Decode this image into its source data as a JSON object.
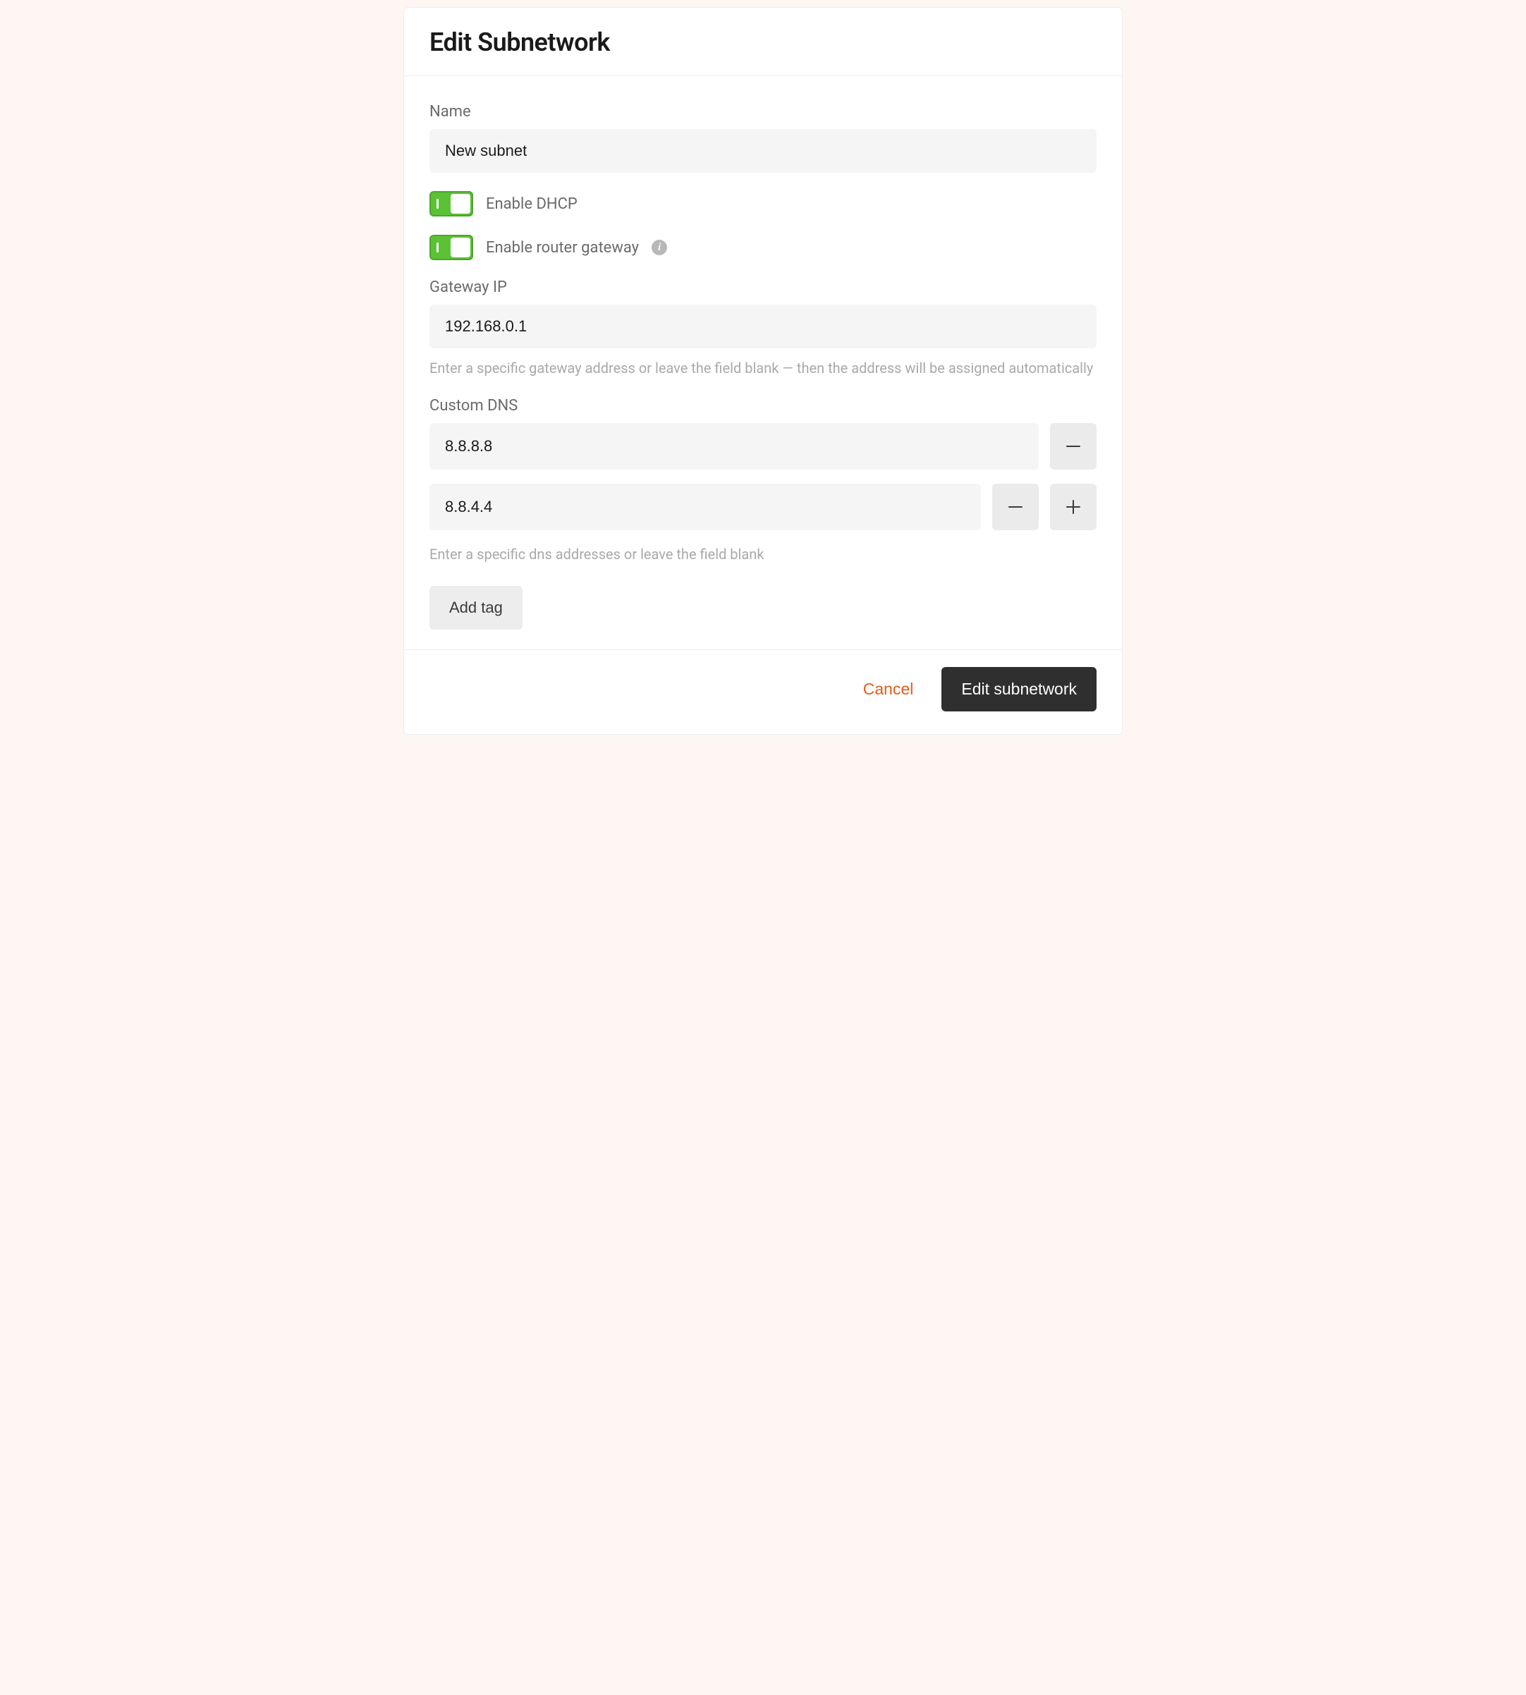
{
  "dialog": {
    "title": "Edit Subnetwork"
  },
  "form": {
    "name": {
      "label": "Name",
      "value": "New subnet"
    },
    "enable_dhcp": {
      "label": "Enable DHCP",
      "checked": true
    },
    "enable_router_gateway": {
      "label": "Enable router gateway",
      "checked": true
    },
    "gateway_ip": {
      "label": "Gateway IP",
      "value": "192.168.0.1",
      "help": "Enter a specific gateway address or leave the field blank — then the address will be assigned automatically"
    },
    "custom_dns": {
      "label": "Custom DNS",
      "entries": [
        {
          "value": "8.8.8.8"
        },
        {
          "value": "8.8.4.4"
        }
      ],
      "help": "Enter a specific dns addresses or leave the field blank"
    },
    "add_tag_label": "Add tag"
  },
  "footer": {
    "cancel_label": "Cancel",
    "submit_label": "Edit subnetwork"
  }
}
